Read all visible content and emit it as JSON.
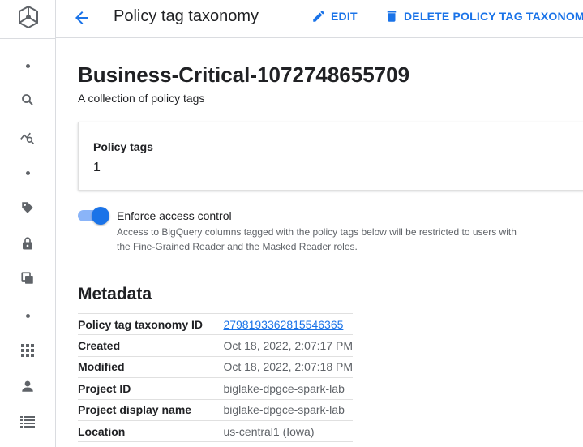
{
  "header": {
    "title": "Policy tag taxonomy",
    "edit_label": "EDIT",
    "delete_label": "DELETE POLICY TAG TAXONOMY"
  },
  "taxonomy": {
    "name": "Business-Critical-1072748655709",
    "description": "A collection of policy tags"
  },
  "policy_tags_card": {
    "label": "Policy tags",
    "count": "1"
  },
  "access_control": {
    "label": "Enforce access control",
    "enabled": true,
    "help": "Access to BigQuery columns tagged with the policy tags below will be restricted to users with the Fine-Grained Reader and the Masked Reader roles."
  },
  "metadata": {
    "title": "Metadata",
    "rows": [
      {
        "key": "Policy tag taxonomy ID",
        "value": "2798193362815546365"
      },
      {
        "key": "Created",
        "value": "Oct 18, 2022, 2:07:17 PM"
      },
      {
        "key": "Modified",
        "value": "Oct 18, 2022, 2:07:18 PM"
      },
      {
        "key": "Project ID",
        "value": "biglake-dpgce-spark-lab"
      },
      {
        "key": "Project display name",
        "value": "biglake-dpgce-spark-lab"
      },
      {
        "key": "Location",
        "value": "us-central1 (Iowa)"
      }
    ]
  },
  "rail_icons": [
    "dataplex-logo",
    "search-icon",
    "insights-icon",
    "tag-icon",
    "lock-icon",
    "copy-icon",
    "apps-icon",
    "person-icon",
    "list-icon"
  ],
  "colors": {
    "accent": "#1a73e8",
    "toggle_track": "#8ab4f8",
    "muted_text": "#5f6368",
    "icon_gray": "#5f6368"
  }
}
